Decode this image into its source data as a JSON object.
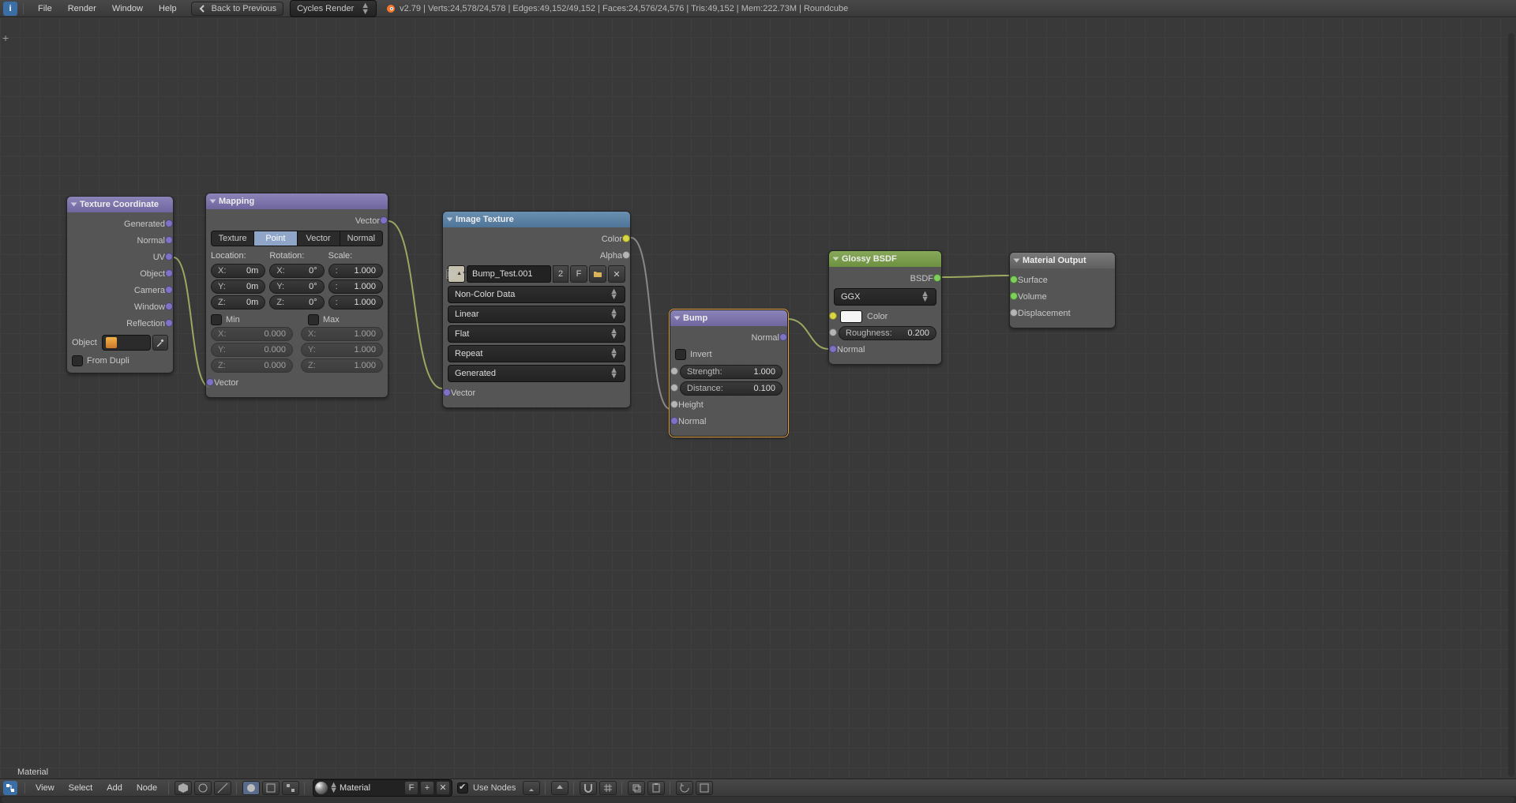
{
  "topbar": {
    "menus": [
      "File",
      "Render",
      "Window",
      "Help"
    ],
    "back_to_previous": "Back to Previous",
    "engine": "Cycles Render",
    "stats": "v2.79 | Verts:24,578/24,578 | Edges:49,152/49,152 | Faces:24,576/24,576 | Tris:49,152 | Mem:222.73M | Roundcube"
  },
  "footer_label": "Material",
  "bottombar": {
    "menus": [
      "View",
      "Select",
      "Add",
      "Node"
    ],
    "material_name": "Material",
    "use_nodes_label": "Use Nodes",
    "use_nodes_checked": true
  },
  "nodes": {
    "texcoord": {
      "title": "Texture Coordinate",
      "outputs": [
        "Generated",
        "Normal",
        "UV",
        "Object",
        "Camera",
        "Window",
        "Reflection"
      ],
      "object_label": "Object",
      "from_dupli": "From Dupli"
    },
    "mapping": {
      "title": "Mapping",
      "out_vector": "Vector",
      "tabs": [
        "Texture",
        "Point",
        "Vector",
        "Normal"
      ],
      "active_tab": 1,
      "loc_label": "Location:",
      "rot_label": "Rotation:",
      "scale_label": "Scale:",
      "loc": [
        [
          "X:",
          "0m"
        ],
        [
          "Y:",
          "0m"
        ],
        [
          "Z:",
          "0m"
        ]
      ],
      "rot": [
        [
          "X:",
          "0°"
        ],
        [
          "Y:",
          "0°"
        ],
        [
          "Z:",
          "0°"
        ]
      ],
      "scale": [
        [
          ":",
          "1.000"
        ],
        [
          ":",
          "1.000"
        ],
        [
          ":",
          "1.000"
        ]
      ],
      "min_label": "Min",
      "max_label": "Max",
      "min": [
        [
          "X:",
          "0.000"
        ],
        [
          "Y:",
          "0.000"
        ],
        [
          "Z:",
          "0.000"
        ]
      ],
      "max": [
        [
          "X:",
          "1.000"
        ],
        [
          "Y:",
          "1.000"
        ],
        [
          "Z:",
          "1.000"
        ]
      ],
      "in_vector": "Vector"
    },
    "imgtex": {
      "title": "Image Texture",
      "out_color": "Color",
      "out_alpha": "Alpha",
      "image_name": "Bump_Test.001",
      "users": "2",
      "fake": "F",
      "color_space": "Non-Color Data",
      "interp": "Linear",
      "proj": "Flat",
      "ext": "Repeat",
      "src": "Generated",
      "in_vector": "Vector"
    },
    "bump": {
      "title": "Bump",
      "out_normal": "Normal",
      "invert": "Invert",
      "strength_label": "Strength:",
      "strength_val": "1.000",
      "distance_label": "Distance:",
      "distance_val": "0.100",
      "in_height": "Height",
      "in_normal": "Normal"
    },
    "glossy": {
      "title": "Glossy BSDF",
      "out_bsdf": "BSDF",
      "distribution": "GGX",
      "color_label": "Color",
      "rough_label": "Roughness:",
      "rough_val": "0.200",
      "in_normal": "Normal"
    },
    "matout": {
      "title": "Material Output",
      "in_surface": "Surface",
      "in_volume": "Volume",
      "in_displacement": "Displacement"
    }
  }
}
